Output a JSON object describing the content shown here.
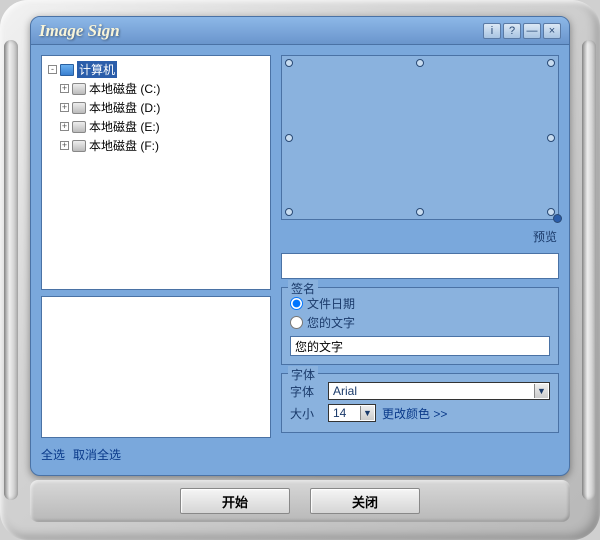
{
  "window": {
    "title": "Image Sign"
  },
  "titlebar": {
    "info": "i",
    "help": "?",
    "min": "—",
    "close": "×"
  },
  "tree": {
    "root": "计算机",
    "drives": [
      {
        "label": "本地磁盘 (C:)"
      },
      {
        "label": "本地磁盘 (D:)"
      },
      {
        "label": "本地磁盘 (E:)"
      },
      {
        "label": "本地磁盘 (F:)"
      }
    ]
  },
  "selection": {
    "select_all": "全选",
    "deselect_all": "取消全选"
  },
  "preview": {
    "label": "预览"
  },
  "signature": {
    "group_title": "签名",
    "opt_file_date": "文件日期",
    "opt_your_text": "您的文字",
    "text_value": "您的文字",
    "selected": "file_date"
  },
  "font": {
    "group_title": "字体",
    "font_label": "字体",
    "font_value": "Arial",
    "size_label": "大小",
    "size_value": "14",
    "more_colors": "更改颜色  >>"
  },
  "actions": {
    "start": "开始",
    "close": "关闭"
  }
}
